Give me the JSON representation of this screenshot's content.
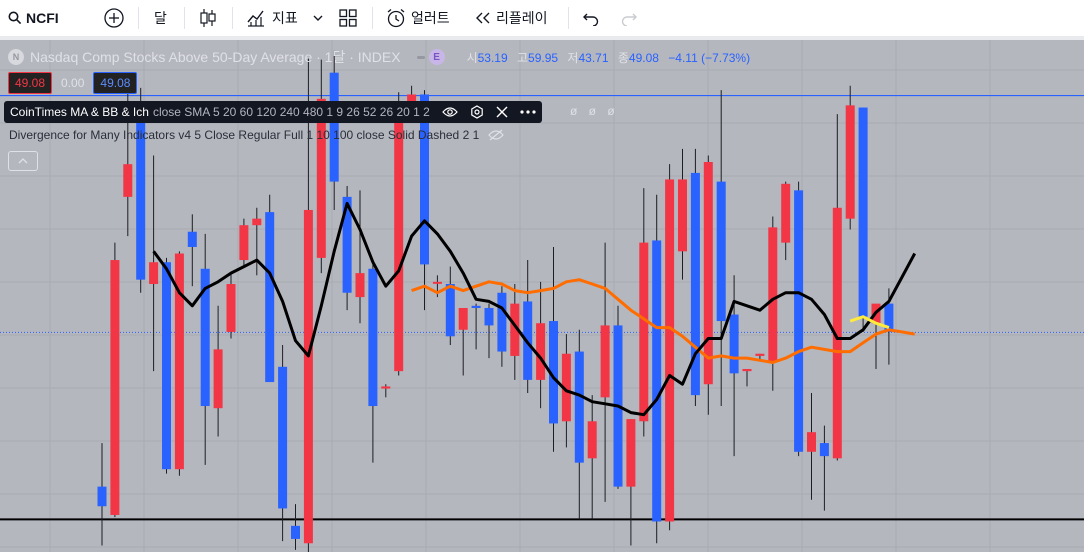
{
  "toolbar": {
    "symbol": "NCFI",
    "interval": "달",
    "indicators_label": "지표",
    "alerts_label": "얼러트",
    "replay_label": "리플레이"
  },
  "legend": {
    "title": "Nasdaq Comp Stocks Above 50-Day Average · 1달 · INDEX",
    "earnings_badge": "E",
    "open_label": "시",
    "open": "53.19",
    "high_label": "고",
    "high": "59.95",
    "low_label": "저",
    "low": "43.71",
    "close_label": "종",
    "close": "49.08",
    "change": "−4.11 (−7.73%)",
    "bid": "49.08",
    "spread": "0.00",
    "ask": "49.08"
  },
  "indicator1": {
    "name": "CoinTimes MA & BB & Ich",
    "args": "close SMA 5 20 60 120 240 480 1 9 26 52 26 20 1 2",
    "trail": "ø ø ø"
  },
  "indicator2": {
    "text": "Divergence for Many Indicators v4 5 Close Regular Full 1 10 100 close Solid Dashed 2 1"
  },
  "colors": {
    "background": "#b5b7bf",
    "up": "#f23645",
    "down": "#2962ff",
    "ma_short": "#000000",
    "ma_long": "#ff6d00",
    "ma_yellow": "#ffeb3b",
    "upper_line": "#2962ff",
    "lower_line": "#000000"
  },
  "chart_data": {
    "type": "candlestick",
    "y_range": [
      39,
      62.5
    ],
    "horizontal_lines": [
      {
        "value": 59.95,
        "color": "#2962ff"
      },
      {
        "value": 40.5,
        "color": "#000000"
      }
    ],
    "current_price_line": 49.08,
    "candles": [
      {
        "o": 42.0,
        "h": 44.0,
        "l": 39.3,
        "c": 41.1
      },
      {
        "o": 40.7,
        "h": 53.2,
        "l": 40.6,
        "c": 52.4
      },
      {
        "o": 55.3,
        "h": 60.2,
        "l": 53.5,
        "c": 56.8
      },
      {
        "o": 59.7,
        "h": 60.3,
        "l": 50.9,
        "c": 51.5
      },
      {
        "o": 51.3,
        "h": 57.2,
        "l": 47.3,
        "c": 52.3
      },
      {
        "o": 52.3,
        "h": 52.5,
        "l": 42.6,
        "c": 42.8
      },
      {
        "o": 42.8,
        "h": 52.8,
        "l": 42.5,
        "c": 52.7
      },
      {
        "o": 53.7,
        "h": 54.5,
        "l": 51.2,
        "c": 53.0
      },
      {
        "o": 52.0,
        "h": 53.6,
        "l": 43.0,
        "c": 45.7
      },
      {
        "o": 45.6,
        "h": 50.3,
        "l": 44.3,
        "c": 48.3
      },
      {
        "o": 49.1,
        "h": 51.8,
        "l": 48.8,
        "c": 51.3
      },
      {
        "o": 52.4,
        "h": 54.3,
        "l": 52.1,
        "c": 54.0
      },
      {
        "o": 54.0,
        "h": 54.8,
        "l": 51.7,
        "c": 54.3
      },
      {
        "o": 54.6,
        "h": 55.4,
        "l": 46.8,
        "c": 46.8
      },
      {
        "o": 47.5,
        "h": 48.5,
        "l": 39.5,
        "c": 41.0
      },
      {
        "o": 40.2,
        "h": 41.2,
        "l": 39.1,
        "c": 39.6
      },
      {
        "o": 39.4,
        "h": 61.7,
        "l": 39.0,
        "c": 54.7
      },
      {
        "o": 52.5,
        "h": 61.6,
        "l": 51.8,
        "c": 59.8
      },
      {
        "o": 61.0,
        "h": 62.0,
        "l": 54.7,
        "c": 56.0
      },
      {
        "o": 55.3,
        "h": 55.8,
        "l": 50.1,
        "c": 50.9
      },
      {
        "o": 50.7,
        "h": 55.6,
        "l": 49.5,
        "c": 51.8
      },
      {
        "o": 52.0,
        "h": 52.3,
        "l": 43.1,
        "c": 45.7
      },
      {
        "o": 46.5,
        "h": 46.7,
        "l": 46.1,
        "c": 46.6
      },
      {
        "o": 47.3,
        "h": 60.1,
        "l": 47.1,
        "c": 59.4
      },
      {
        "o": 59.5,
        "h": 60.4,
        "l": 58.9,
        "c": 60.0
      },
      {
        "o": 60.0,
        "h": 60.2,
        "l": 50.1,
        "c": 52.2
      },
      {
        "o": 51.4,
        "h": 51.7,
        "l": 50.7,
        "c": 51.4
      },
      {
        "o": 51.3,
        "h": 52.1,
        "l": 48.5,
        "c": 48.9
      },
      {
        "o": 49.2,
        "h": 50.1,
        "l": 47.1,
        "c": 50.2
      },
      {
        "o": 50.3,
        "h": 50.4,
        "l": 48.3,
        "c": 50.2
      },
      {
        "o": 50.2,
        "h": 50.4,
        "l": 47.9,
        "c": 49.4
      },
      {
        "o": 50.9,
        "h": 51.2,
        "l": 47.5,
        "c": 48.2
      },
      {
        "o": 48.0,
        "h": 51.3,
        "l": 46.9,
        "c": 50.4
      },
      {
        "o": 50.5,
        "h": 52.4,
        "l": 46.3,
        "c": 46.9
      },
      {
        "o": 46.9,
        "h": 51.4,
        "l": 45.6,
        "c": 49.5
      },
      {
        "o": 49.6,
        "h": 53.0,
        "l": 43.6,
        "c": 44.9
      },
      {
        "o": 45.0,
        "h": 49.0,
        "l": 43.8,
        "c": 48.1
      },
      {
        "o": 48.2,
        "h": 49.2,
        "l": 40.5,
        "c": 43.1
      },
      {
        "o": 43.3,
        "h": 46.2,
        "l": 40.5,
        "c": 45.0
      },
      {
        "o": 46.1,
        "h": 53.2,
        "l": 41.3,
        "c": 49.4
      },
      {
        "o": 49.4,
        "h": 50.3,
        "l": 41.9,
        "c": 42.0
      },
      {
        "o": 42.0,
        "h": 45.1,
        "l": 39.3,
        "c": 45.1
      },
      {
        "o": 45.0,
        "h": 55.7,
        "l": 44.3,
        "c": 53.2
      },
      {
        "o": 53.3,
        "h": 55.4,
        "l": 39.4,
        "c": 40.4
      },
      {
        "o": 40.4,
        "h": 56.8,
        "l": 40.0,
        "c": 56.1
      },
      {
        "o": 52.8,
        "h": 57.5,
        "l": 51.5,
        "c": 56.1
      },
      {
        "o": 56.4,
        "h": 57.5,
        "l": 45.7,
        "c": 46.2
      },
      {
        "o": 46.7,
        "h": 57.2,
        "l": 45.3,
        "c": 56.9
      },
      {
        "o": 56.0,
        "h": 60.2,
        "l": 45.7,
        "c": 49.6
      },
      {
        "o": 49.9,
        "h": 51.7,
        "l": 43.4,
        "c": 47.2
      },
      {
        "o": 47.3,
        "h": 47.4,
        "l": 46.6,
        "c": 47.4
      },
      {
        "o": 48.0,
        "h": 48.1,
        "l": 47.8,
        "c": 48.1
      },
      {
        "o": 47.7,
        "h": 54.4,
        "l": 46.4,
        "c": 53.9
      },
      {
        "o": 53.2,
        "h": 56.0,
        "l": 52.4,
        "c": 55.9
      },
      {
        "o": 55.6,
        "h": 56.0,
        "l": 43.4,
        "c": 43.6
      },
      {
        "o": 43.6,
        "h": 46.3,
        "l": 41.4,
        "c": 44.5
      },
      {
        "o": 44.0,
        "h": 44.8,
        "l": 40.9,
        "c": 43.4
      },
      {
        "o": 43.3,
        "h": 59.1,
        "l": 43.2,
        "c": 54.8
      },
      {
        "o": 54.3,
        "h": 60.4,
        "l": 53.8,
        "c": 59.5
      },
      {
        "o": 59.4,
        "h": 59.4,
        "l": 49.1,
        "c": 49.8
      },
      {
        "o": 49.5,
        "h": 50.3,
        "l": 47.4,
        "c": 50.4
      },
      {
        "o": 50.4,
        "h": 51.1,
        "l": 47.6,
        "c": 49.1
      }
    ],
    "ma_short": [
      null,
      null,
      null,
      null,
      52.8,
      52.0,
      50.9,
      50.3,
      51.1,
      51.4,
      51.8,
      52.1,
      52.4,
      51.8,
      50.5,
      48.7,
      48.0,
      50.3,
      52.8,
      55.0,
      53.8,
      52.3,
      51.2,
      51.9,
      53.5,
      54.2,
      53.6,
      52.8,
      51.8,
      50.6,
      50.5,
      50.2,
      49.4,
      48.6,
      47.9,
      47.0,
      46.4,
      46.2,
      45.9,
      45.8,
      45.7,
      45.4,
      45.3,
      46.0,
      47.1,
      46.7,
      48.1,
      48.8,
      48.8,
      50.5,
      50.3,
      50.1,
      50.6,
      50.9,
      50.9,
      50.6,
      49.9,
      48.8,
      48.8,
      49.2,
      50.0,
      50.5,
      51.6,
      52.7
    ],
    "ma_long": [
      null,
      null,
      null,
      null,
      null,
      null,
      null,
      null,
      null,
      null,
      null,
      null,
      null,
      null,
      null,
      null,
      null,
      null,
      null,
      null,
      null,
      null,
      null,
      null,
      51.0,
      51.2,
      50.9,
      51.2,
      51.0,
      51.2,
      51.4,
      51.3,
      51.0,
      50.9,
      51.0,
      51.1,
      51.4,
      51.5,
      51.3,
      51.1,
      50.6,
      50.1,
      49.7,
      49.3,
      49.3,
      48.9,
      48.4,
      47.9,
      48.0,
      47.9,
      47.9,
      47.8,
      47.7,
      47.9,
      48.2,
      48.4,
      48.3,
      48.2,
      48.2,
      48.6,
      49.0,
      49.2,
      49.1,
      49.0
    ]
  }
}
